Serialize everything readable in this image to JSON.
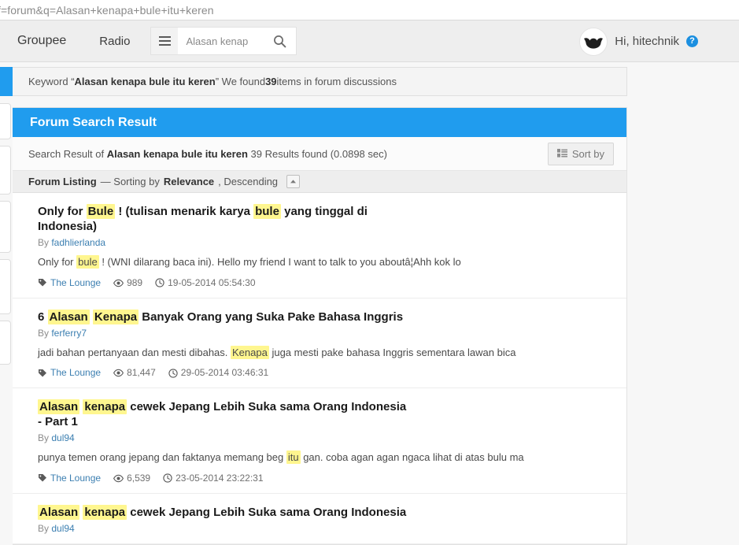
{
  "browser": {
    "url_fragment": "f=forum&q=Alasan+kenapa+bule+itu+keren"
  },
  "navbar": {
    "brand": "Groupee",
    "radio_link": "Radio",
    "menu_icon": "hamburger-icon",
    "search": {
      "value": "",
      "placeholder": "Alasan kenap",
      "submit_icon": "search-icon"
    },
    "greeting": "Hi, hitechnik",
    "help_icon_label": "?",
    "avatar_icon": "user-avatar-bat"
  },
  "keyword_bar": {
    "prefix": "Keyword “",
    "keyword": "Alasan kenapa bule itu keren",
    "middle": "” We found ",
    "count": "39",
    "suffix": " items in forum discussions"
  },
  "panel": {
    "title": "Forum Search Result",
    "summary_prefix": "Search Result of ",
    "summary_keyword": "Alasan kenapa bule itu keren",
    "summary_suffix": " 39 Results found (0.0898 sec)",
    "sort_by_label": "Sort by",
    "sort_by_icon": "list-grid-icon"
  },
  "listing_header": {
    "label": "Forum Listing",
    "dash": " — Sorting by ",
    "sort_field": "Relevance",
    "sort_direction": ", Descending",
    "collapse_icon": "caret-up-icon"
  },
  "results": [
    {
      "title_parts": [
        {
          "t": "Only for ",
          "h": false
        },
        {
          "t": "Bule",
          "h": true
        },
        {
          "t": " ! (tulisan menarik karya ",
          "h": false
        },
        {
          "t": "bule",
          "h": true
        },
        {
          "t": " yang tinggal di Indonesia)",
          "h": false
        }
      ],
      "by_label": "By ",
      "author": "fadhlierlanda",
      "snippet_parts": [
        {
          "t": "Only for ",
          "h": false
        },
        {
          "t": "bule",
          "h": true
        },
        {
          "t": " ! (WNI dilarang baca ini). Hello my friend I want to talk to you aboutâ¦Ahh kok lo",
          "h": false
        }
      ],
      "forum": "The Lounge",
      "views": "989",
      "date": "19-05-2014 05:54:30",
      "tag_icon": "tag-icon",
      "views_icon": "eye-icon",
      "date_icon": "clock-icon"
    },
    {
      "title_parts": [
        {
          "t": "6 ",
          "h": false
        },
        {
          "t": "Alasan",
          "h": true
        },
        {
          "t": " ",
          "h": false
        },
        {
          "t": "Kenapa",
          "h": true
        },
        {
          "t": " Banyak Orang yang Suka Pake Bahasa Inggris",
          "h": false
        }
      ],
      "by_label": "By ",
      "author": "ferferry7",
      "snippet_parts": [
        {
          "t": "jadi bahan pertanyaan dan mesti dibahas. ",
          "h": false
        },
        {
          "t": "Kenapa",
          "h": true
        },
        {
          "t": " juga mesti pake bahasa Inggris sementara lawan bica",
          "h": false
        }
      ],
      "forum": "The Lounge",
      "views": "81,447",
      "date": "29-05-2014 03:46:31",
      "tag_icon": "tag-icon",
      "views_icon": "eye-icon",
      "date_icon": "clock-icon"
    },
    {
      "title_parts": [
        {
          "t": "Alasan",
          "h": true
        },
        {
          "t": " ",
          "h": false
        },
        {
          "t": "kenapa",
          "h": true
        },
        {
          "t": " cewek Jepang Lebih Suka sama Orang Indonesia - Part 1",
          "h": false
        }
      ],
      "by_label": "By ",
      "author": "dul94",
      "snippet_parts": [
        {
          "t": "punya temen orang jepang dan faktanya memang beg ",
          "h": false
        },
        {
          "t": "itu",
          "h": true
        },
        {
          "t": " gan. coba agan agan ngaca lihat di atas bulu ma",
          "h": false
        }
      ],
      "forum": "The Lounge",
      "views": "6,539",
      "date": "23-05-2014 23:22:31",
      "tag_icon": "tag-icon",
      "views_icon": "eye-icon",
      "date_icon": "clock-icon"
    },
    {
      "title_parts": [
        {
          "t": "Alasan",
          "h": true
        },
        {
          "t": " ",
          "h": false
        },
        {
          "t": "kenapa",
          "h": true
        },
        {
          "t": " cewek Jepang Lebih Suka sama Orang Indonesia",
          "h": false
        }
      ],
      "by_label": "By ",
      "author": "dul94",
      "snippet_parts": [],
      "forum": "",
      "views": "",
      "date": "",
      "tag_icon": "tag-icon",
      "views_icon": "eye-icon",
      "date_icon": "clock-icon"
    }
  ],
  "colors": {
    "accent_blue": "#209cee",
    "highlight_yellow": "#fff68f",
    "link_blue": "#3c7fb1",
    "page_bg": "#f7f7f7"
  }
}
